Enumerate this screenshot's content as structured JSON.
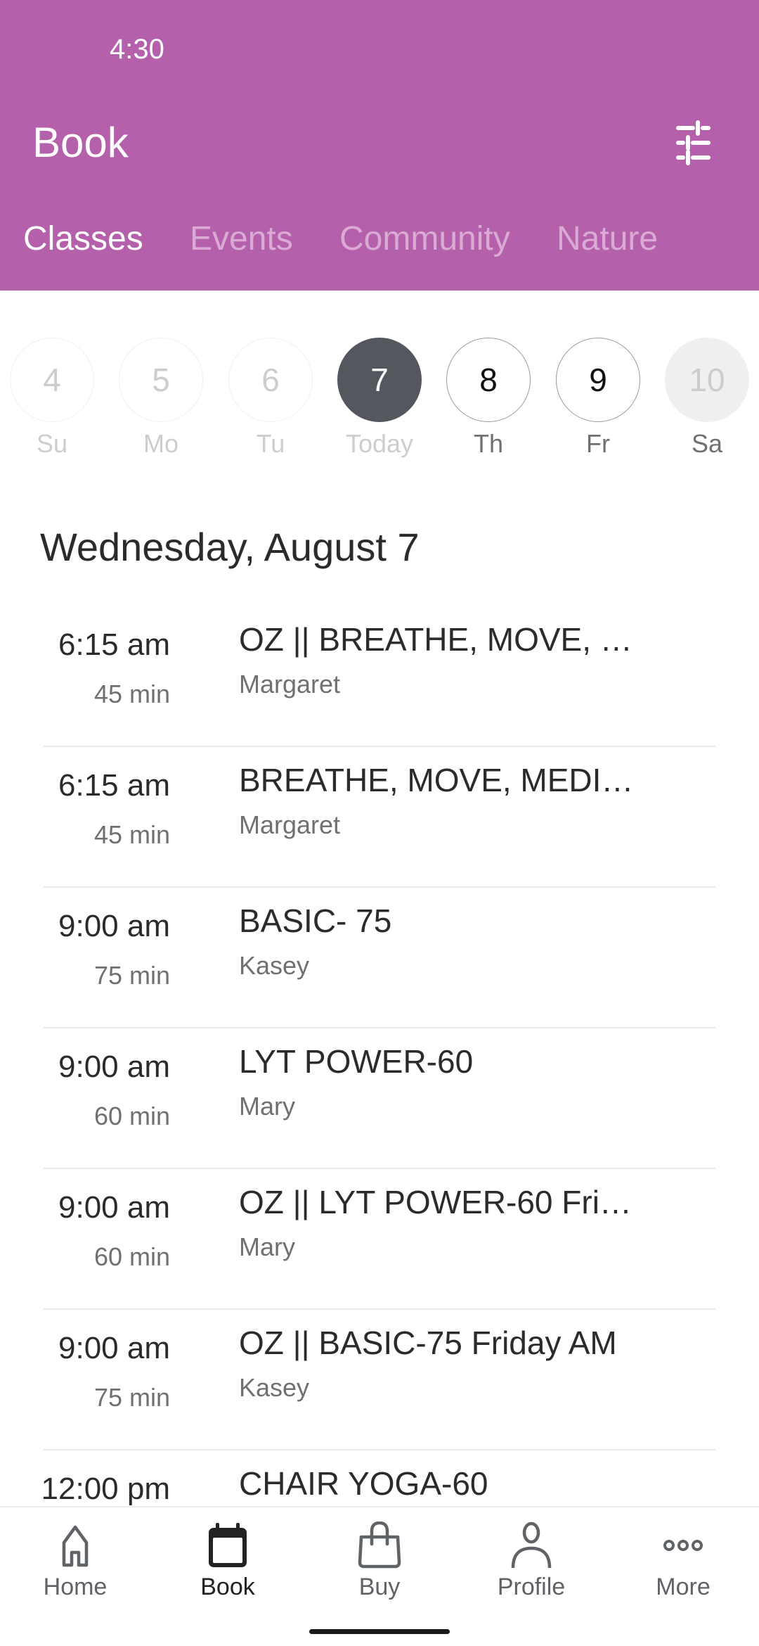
{
  "status_bar": {
    "time": "4:30"
  },
  "header": {
    "title": "Book",
    "filter_icon": "sliders-icon",
    "background_color": "#b460ab"
  },
  "tabs": [
    {
      "label": "Classes",
      "active": true
    },
    {
      "label": "Events",
      "active": false
    },
    {
      "label": "Community",
      "active": false
    },
    {
      "label": "Nature",
      "active": false
    }
  ],
  "date_strip": [
    {
      "day": "4",
      "label": "Su",
      "state": "past"
    },
    {
      "day": "5",
      "label": "Mo",
      "state": "past"
    },
    {
      "day": "6",
      "label": "Tu",
      "state": "past"
    },
    {
      "day": "7",
      "label": "Today",
      "state": "today"
    },
    {
      "day": "8",
      "label": "Th",
      "state": "future"
    },
    {
      "day": "9",
      "label": "Fr",
      "state": "future"
    },
    {
      "day": "10",
      "label": "Sa",
      "state": "weekend"
    }
  ],
  "date_heading": "Wednesday, August 7",
  "classes": [
    {
      "time": "6:15 am",
      "duration": "45 min",
      "name": "OZ || BREATHE, MOVE, …",
      "instructor": "Margaret"
    },
    {
      "time": "6:15 am",
      "duration": "45 min",
      "name": "BREATHE, MOVE, MEDI…",
      "instructor": "Margaret"
    },
    {
      "time": "9:00 am",
      "duration": "75 min",
      "name": "BASIC- 75",
      "instructor": "Kasey"
    },
    {
      "time": "9:00 am",
      "duration": "60 min",
      "name": "LYT POWER-60",
      "instructor": "Mary"
    },
    {
      "time": "9:00 am",
      "duration": "60 min",
      "name": "OZ || LYT POWER-60 Fri…",
      "instructor": "Mary"
    },
    {
      "time": "9:00 am",
      "duration": "75 min",
      "name": "OZ || BASIC-75 Friday AM",
      "instructor": "Kasey"
    },
    {
      "time": "12:00 pm",
      "duration": "",
      "name": "CHAIR YOGA-60",
      "instructor": ""
    }
  ],
  "bottom_nav": [
    {
      "label": "Home",
      "icon": "home-icon",
      "active": false
    },
    {
      "label": "Book",
      "icon": "calendar-icon",
      "active": true
    },
    {
      "label": "Buy",
      "icon": "shopping-bag-icon",
      "active": false
    },
    {
      "label": "Profile",
      "icon": "person-icon",
      "active": false
    },
    {
      "label": "More",
      "icon": "more-dots-icon",
      "active": false
    }
  ]
}
